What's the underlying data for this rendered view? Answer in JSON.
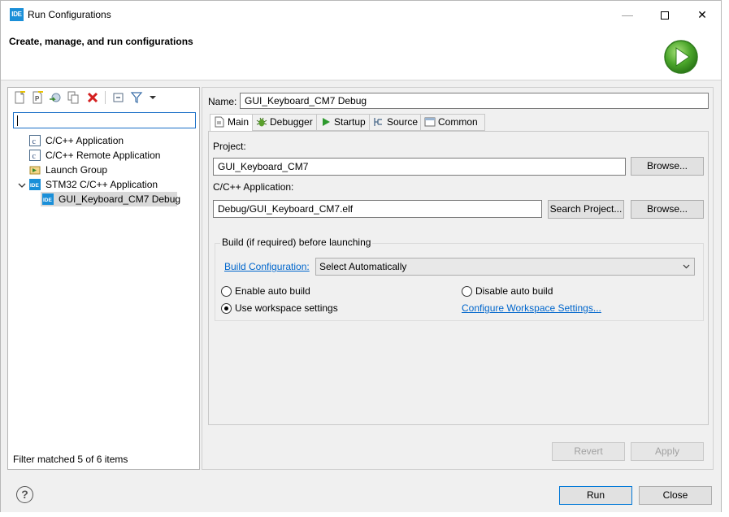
{
  "window": {
    "app_icon_text": "IDE",
    "title": "Run Configurations",
    "minimize_glyph": "—",
    "close_glyph": "✕"
  },
  "header": {
    "title": "Create, manage, and run configurations"
  },
  "left": {
    "filter_value": "",
    "tree": [
      {
        "label": "C/C++ Application",
        "icon": "c-app-icon",
        "level": 1
      },
      {
        "label": "C/C++ Remote Application",
        "icon": "c-remote-app-icon",
        "level": 1
      },
      {
        "label": "Launch Group",
        "icon": "launch-group-icon",
        "level": 1
      },
      {
        "label": "STM32 C/C++ Application",
        "icon": "ide-icon",
        "level": 0,
        "expanded": true
      },
      {
        "label": "GUI_Keyboard_CM7 Debug",
        "icon": "ide-icon",
        "level": 2,
        "selected": true
      }
    ],
    "ide_badge": "IDE",
    "c_badge": "c",
    "filter_status": "Filter matched 5 of 6 items"
  },
  "right": {
    "name_label": "Name:",
    "name_value": "GUI_Keyboard_CM7 Debug",
    "tabs": [
      {
        "label": "Main",
        "icon": "main-tab-icon",
        "active": true
      },
      {
        "label": "Debugger",
        "icon": "bug-icon"
      },
      {
        "label": "Startup",
        "icon": "play-icon"
      },
      {
        "label": "Source",
        "icon": "source-icon"
      },
      {
        "label": "Common",
        "icon": "common-icon"
      }
    ],
    "project_label": "Project:",
    "project_value": "GUI_Keyboard_CM7",
    "browse_label": "Browse...",
    "app_label": "C/C++ Application:",
    "app_value": "Debug/GUI_Keyboard_CM7.elf",
    "search_project_label": "Search Project...",
    "build": {
      "group_title": "Build (if required) before launching",
      "config_link": "Build Configuration:",
      "config_value": "Select Automatically",
      "enable_auto": "Enable auto build",
      "disable_auto": "Disable auto build",
      "use_workspace": "Use workspace settings",
      "configure_link": "Configure Workspace Settings...",
      "selected": "use_workspace"
    },
    "revert_label": "Revert",
    "apply_label": "Apply"
  },
  "footer": {
    "help_glyph": "?",
    "run_label": "Run",
    "close_label": "Close"
  }
}
